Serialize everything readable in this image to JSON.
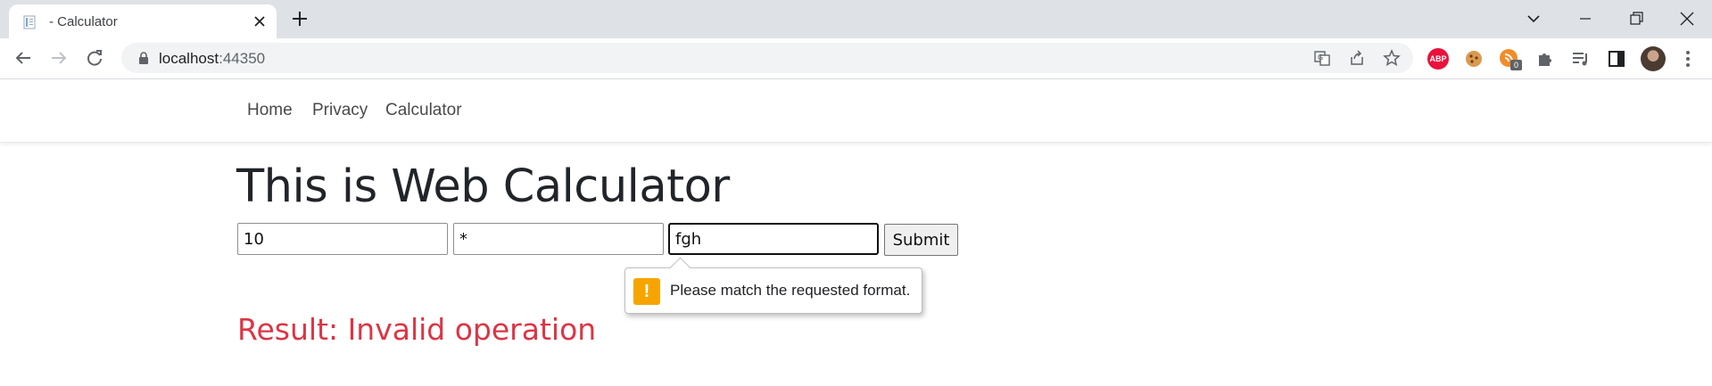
{
  "browser": {
    "tab_title": "- Calculator",
    "url_host": "localhost",
    "url_port": ":44350",
    "extension_badge": "0",
    "abp_label": "ABP"
  },
  "nav": {
    "links": [
      "Home",
      "Privacy",
      "Calculator"
    ]
  },
  "page": {
    "title": "This is Web Calculator",
    "operand1": "10",
    "operator": "*",
    "operand2": "fgh",
    "submit_label": "Submit",
    "validation_message": "Please match the requested format.",
    "result": "Result: Invalid operation"
  },
  "colors": {
    "result_text": "#dc3545",
    "warning_icon": "#f6a500",
    "tabstrip": "#dee1e6"
  },
  "icons": [
    "favicon-icon",
    "close-icon",
    "plus-icon",
    "chevron-down-icon",
    "minimize-icon",
    "restore-icon",
    "close-window-icon",
    "back-icon",
    "forward-icon",
    "reload-icon",
    "lock-icon",
    "translate-icon",
    "share-icon",
    "star-icon",
    "adblock-icon",
    "cookie-icon",
    "rss-extension-icon",
    "puzzle-icon",
    "media-queue-icon",
    "side-panel-icon",
    "avatar",
    "kebab-menu-icon",
    "warning-icon"
  ]
}
